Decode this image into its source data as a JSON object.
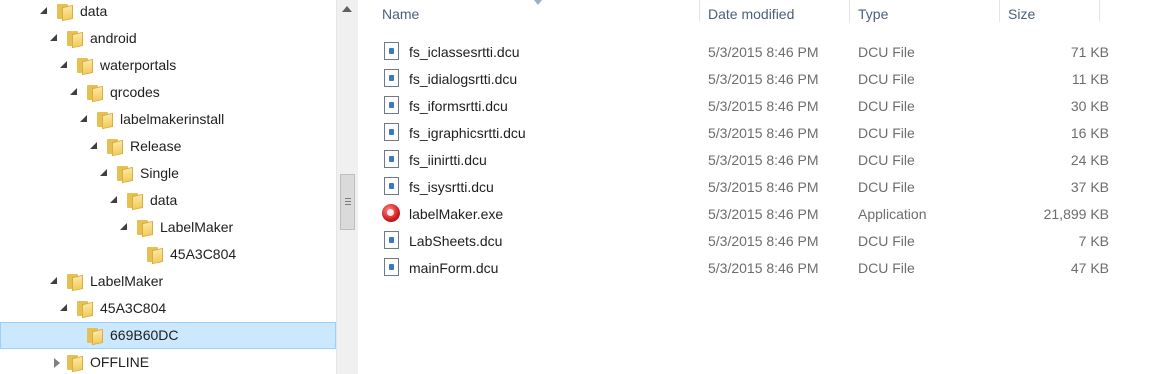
{
  "nav_tree": [
    {
      "label": "data",
      "state": "expanded"
    },
    {
      "label": "android",
      "state": "expanded"
    },
    {
      "label": "waterportals",
      "state": "expanded"
    },
    {
      "label": "qrcodes",
      "state": "expanded"
    },
    {
      "label": "labelmakerinstall",
      "state": "expanded"
    },
    {
      "label": "Release",
      "state": "expanded"
    },
    {
      "label": "Single",
      "state": "expanded"
    },
    {
      "label": "data",
      "state": "expanded"
    },
    {
      "label": "LabelMaker",
      "state": "expanded"
    },
    {
      "label": "45A3C804",
      "state": "none"
    },
    {
      "label": "LabelMaker",
      "state": "expanded"
    },
    {
      "label": "45A3C804",
      "state": "expanded"
    },
    {
      "label": "669B60DC",
      "state": "none",
      "selected": true
    },
    {
      "label": "OFFLINE",
      "state": "collapsed"
    }
  ],
  "columns": {
    "name": "Name",
    "date": "Date modified",
    "type": "Type",
    "size": "Size"
  },
  "files": [
    {
      "name": "fs_iclassesrtti.dcu",
      "date": "5/3/2015 8:46 PM",
      "type": "DCU File",
      "size": "71 KB",
      "icon": "dcu-file-icon"
    },
    {
      "name": "fs_idialogsrtti.dcu",
      "date": "5/3/2015 8:46 PM",
      "type": "DCU File",
      "size": "11 KB",
      "icon": "dcu-file-icon"
    },
    {
      "name": "fs_iformsrtti.dcu",
      "date": "5/3/2015 8:46 PM",
      "type": "DCU File",
      "size": "30 KB",
      "icon": "dcu-file-icon"
    },
    {
      "name": "fs_igraphicsrtti.dcu",
      "date": "5/3/2015 8:46 PM",
      "type": "DCU File",
      "size": "16 KB",
      "icon": "dcu-file-icon"
    },
    {
      "name": "fs_iinirtti.dcu",
      "date": "5/3/2015 8:46 PM",
      "type": "DCU File",
      "size": "24 KB",
      "icon": "dcu-file-icon"
    },
    {
      "name": "fs_isysrtti.dcu",
      "date": "5/3/2015 8:46 PM",
      "type": "DCU File",
      "size": "37 KB",
      "icon": "dcu-file-icon"
    },
    {
      "name": "labelMaker.exe",
      "date": "5/3/2015 8:46 PM",
      "type": "Application",
      "size": "21,899 KB",
      "icon": "application-icon"
    },
    {
      "name": "LabSheets.dcu",
      "date": "5/3/2015 8:46 PM",
      "type": "DCU File",
      "size": "7 KB",
      "icon": "dcu-file-icon"
    },
    {
      "name": "mainForm.dcu",
      "date": "5/3/2015 8:46 PM",
      "type": "DCU File",
      "size": "47 KB",
      "icon": "dcu-file-icon"
    }
  ]
}
